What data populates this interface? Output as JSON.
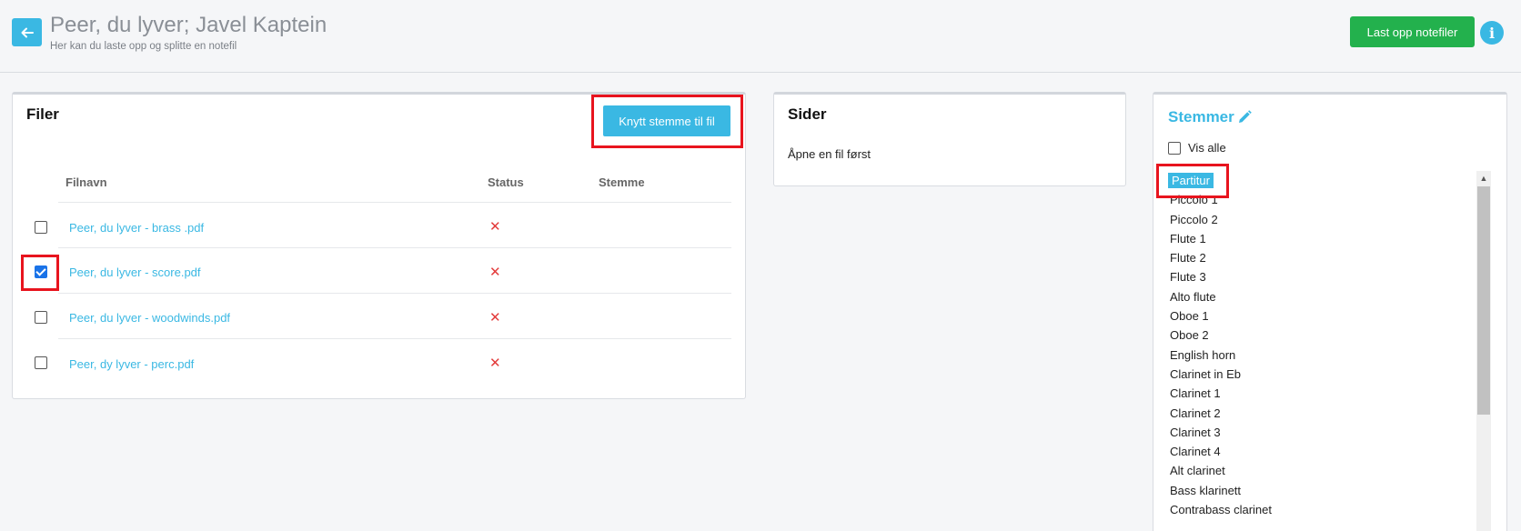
{
  "header": {
    "title": "Peer, du lyver; Javel Kaptein",
    "subtitle": "Her kan du laste opp og splitte en notefil",
    "upload_label": "Last opp notefiler",
    "info_label": "i"
  },
  "files": {
    "title": "Filer",
    "attach_label": "Knytt stemme til fil",
    "columns": [
      "Filnavn",
      "Status",
      "Stemme"
    ],
    "rows": [
      {
        "name": "Peer, du lyver - brass .pdf",
        "checked": false,
        "status": "✕",
        "stemme": ""
      },
      {
        "name": "Peer, du lyver - score.pdf",
        "checked": true,
        "status": "✕",
        "stemme": ""
      },
      {
        "name": "Peer, du lyver - woodwinds.pdf",
        "checked": false,
        "status": "✕",
        "stemme": ""
      },
      {
        "name": "Peer, dy lyver - perc.pdf",
        "checked": false,
        "status": "✕",
        "stemme": ""
      }
    ]
  },
  "sider": {
    "title": "Sider",
    "empty_text": "Åpne en fil først"
  },
  "stemmer": {
    "title": "Stemmer",
    "show_all_label": "Vis alle",
    "show_all_checked": false,
    "selected": "Partitur",
    "voices": [
      "Partitur",
      "Piccolo 1",
      "Piccolo 2",
      "Flute 1",
      "Flute 2",
      "Flute 3",
      "Alto flute",
      "Oboe 1",
      "Oboe 2",
      "English horn",
      "Clarinet in Eb",
      "Clarinet 1",
      "Clarinet 2",
      "Clarinet 3",
      "Clarinet 4",
      "Alt clarinet",
      "Bass klarinett",
      "Contrabass clarinet"
    ]
  },
  "colors": {
    "accent": "#3ab8e3",
    "success": "#23b14d",
    "error": "#e33b3b",
    "highlight": "#e8141e"
  }
}
